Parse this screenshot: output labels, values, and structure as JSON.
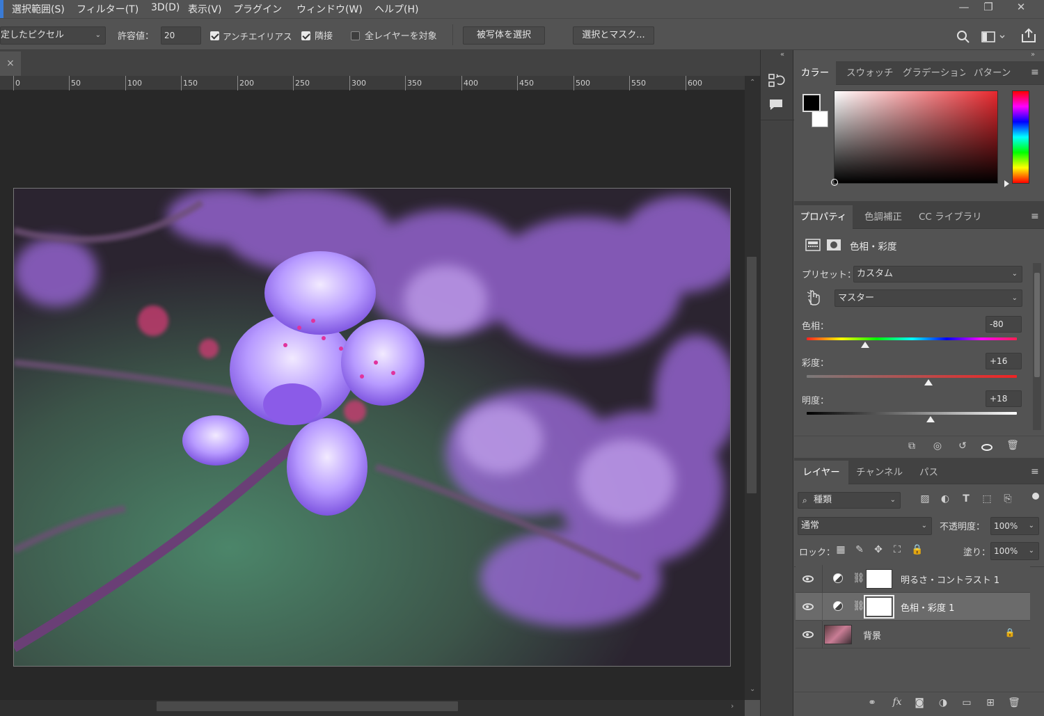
{
  "menu": [
    "選択範囲(S)",
    "フィルター(T)",
    "3D(D)",
    "表示(V)",
    "プラグイン",
    "ウィンドウ(W)",
    "ヘルプ(H)"
  ],
  "window_controls": {
    "minimize": "—",
    "restore": "❐",
    "close": "✕"
  },
  "options": {
    "sample_mode": "定したピクセル",
    "tolerance_label": "許容値：",
    "tolerance_value": "20",
    "antialias_label": "アンチエイリアス",
    "antialias_checked": true,
    "contiguous_label": "隣接",
    "contiguous_checked": true,
    "all_layers_label": "全レイヤーを対象",
    "all_layers_checked": false,
    "select_subject": "被写体を選択",
    "select_mask": "選択とマスク..."
  },
  "document": {
    "close_glyph": "×"
  },
  "ruler": {
    "ticks": [
      "0",
      "50",
      "100",
      "150",
      "200",
      "250",
      "300",
      "350",
      "400",
      "450",
      "500",
      "550",
      "600"
    ]
  },
  "color_panel": {
    "tabs": [
      "カラー",
      "スウォッチ",
      "グラデーション",
      "パターン"
    ],
    "foreground": "#000000",
    "background": "#ffffff",
    "hue_color": "#e8282e"
  },
  "properties": {
    "tabs": [
      "プロパティ",
      "色調補正",
      "CC ライブラリ"
    ],
    "adjustment_title": "色相・彩度",
    "preset_label": "プリセット：",
    "preset_value": "カスタム",
    "channel_value": "マスター",
    "hue_label": "色相：",
    "hue_value": "-80",
    "hue_slider": -80,
    "saturation_label": "彩度：",
    "saturation_value": "+16",
    "saturation_slider": 16,
    "lightness_label": "明度：",
    "lightness_value": "+18",
    "lightness_slider": 18
  },
  "layers": {
    "tabs": [
      "レイヤー",
      "チャンネル",
      "パス"
    ],
    "filter_value": "種類",
    "blend_mode": "通常",
    "opacity_label": "不透明度：",
    "opacity_value": "100%",
    "lock_label": "ロック：",
    "fill_label": "塗り：",
    "fill_value": "100%",
    "items": [
      {
        "name": "明るさ・コントラスト 1",
        "type": "adjustment",
        "selected": false
      },
      {
        "name": "色相・彩度 1",
        "type": "adjustment",
        "selected": true
      },
      {
        "name": "背景",
        "type": "image",
        "selected": false,
        "locked": true
      }
    ]
  },
  "icons": [
    "search-icon",
    "workspace-icon",
    "share-icon",
    "history-icon",
    "comment-icon",
    "adjustment-layer-icon",
    "mask-icon",
    "eye-icon",
    "chain-link-icon",
    "lock-icon",
    "trash-icon",
    "fx-icon",
    "folder-icon",
    "new-layer-icon",
    "targeted-adjust-icon",
    "reset-icon",
    "clip-icon"
  ]
}
